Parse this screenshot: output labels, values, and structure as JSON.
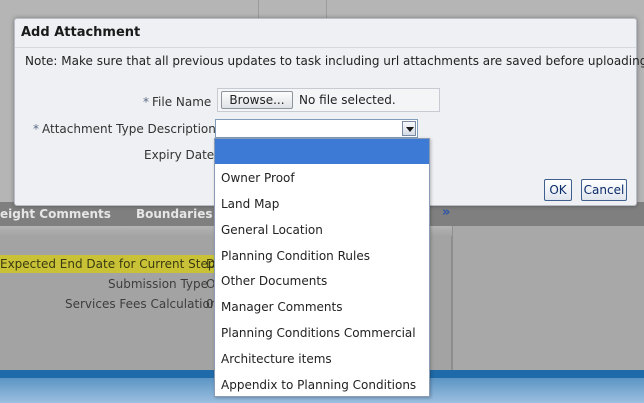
{
  "dialog": {
    "title": "Add Attachment",
    "note": "Note: Make sure that all previous updates to task including url attachments are saved before uploading file.",
    "file_name_label": "File Name",
    "browse_label": "Browse...",
    "no_file_text": "No file selected.",
    "attachment_type_label": "Attachment Type Description",
    "required_marker": "*",
    "expiry_date_label": "Expiry Date",
    "ok_label": "OK",
    "cancel_label": "Cancel"
  },
  "dropdown": {
    "selected_value": "",
    "options": [
      "",
      "Owner Proof",
      "Land Map",
      "General Location",
      "Planning Condition Rules",
      "Other Documents",
      "Manager Comments",
      "Planning Conditions Commercial",
      "Architecture items",
      "Appendix to Planning Conditions"
    ]
  },
  "background": {
    "tabs": [
      "eight Comments",
      "Boundaries a"
    ],
    "more_icon": "double-chevron-right-icon",
    "chevron_text": "»",
    "rows": [
      {
        "label": "Expected End Date for Current Step",
        "value": "D"
      },
      {
        "label": "Submission Type",
        "value": "O"
      },
      {
        "label": "Services Fees Calculation",
        "value": "0"
      }
    ]
  },
  "colors": {
    "selected_option": "#3d7ad6",
    "highlight_row": "#c9c237",
    "button_text": "#0b2c6b"
  }
}
